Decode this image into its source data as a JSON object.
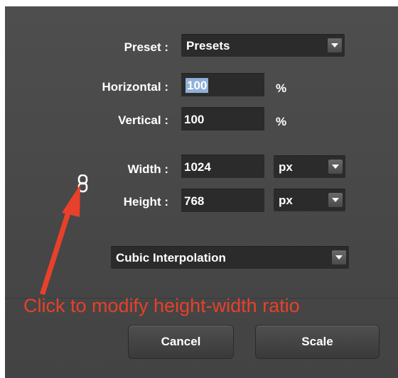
{
  "preset": {
    "label": "Preset :",
    "value": "Presets"
  },
  "horizontal": {
    "label": "Horizontal :",
    "value": "100",
    "unit": "%"
  },
  "vertical": {
    "label": "Vertical :",
    "value": "100",
    "unit": "%"
  },
  "width": {
    "label": "Width :",
    "value": "1024",
    "unit": "px"
  },
  "height": {
    "label": "Height :",
    "value": "768",
    "unit": "px"
  },
  "interpolation": {
    "value": "Cubic Interpolation"
  },
  "annotation": {
    "text": "Click to modify height-width ratio",
    "color": "#e8402a"
  },
  "buttons": {
    "cancel": "Cancel",
    "scale": "Scale"
  },
  "icons": {
    "link": "chain-link-icon",
    "arrow": "red-arrow"
  }
}
